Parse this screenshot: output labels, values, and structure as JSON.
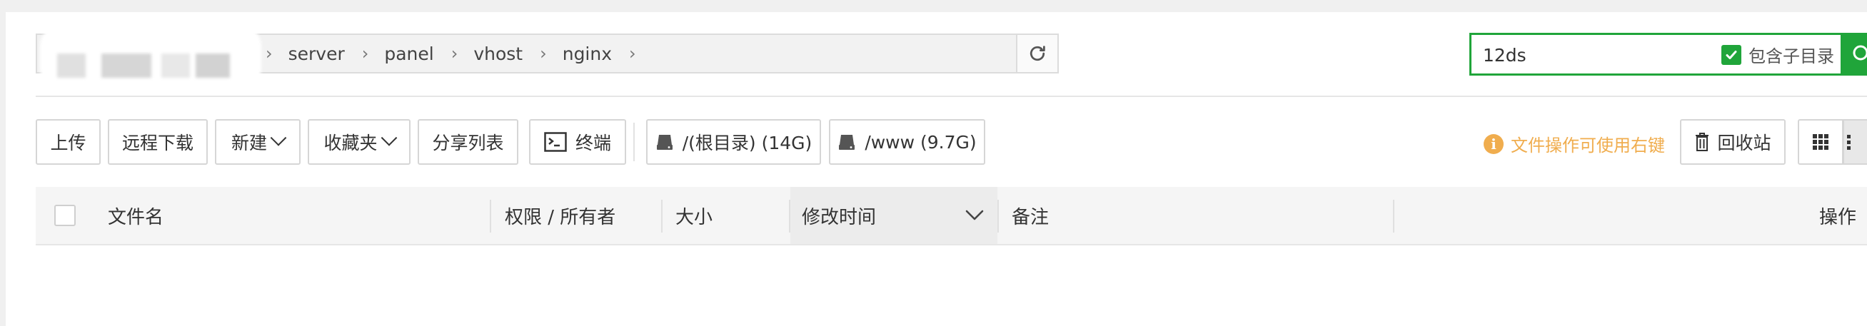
{
  "path": {
    "crumbs": [
      "server",
      "panel",
      "vhost",
      "nginx"
    ],
    "separator": "›"
  },
  "search": {
    "value": "12ds",
    "subdir_label": "包含子目录",
    "subdir_checked": true
  },
  "toolbar": {
    "upload": "上传",
    "remote_download": "远程下载",
    "new": "新建",
    "favorites": "收藏夹",
    "share_list": "分享列表",
    "terminal": "终端",
    "disk_root": "/(根目录) (14G)",
    "disk_www": "/www (9.7G)",
    "hint": "文件操作可使用右键",
    "recycle_bin": "回收站"
  },
  "table": {
    "columns": {
      "filename": "文件名",
      "permission": "权限 / 所有者",
      "size": "大小",
      "mtime": "修改时间",
      "note": "备注",
      "actions": "操作"
    }
  },
  "colors": {
    "accent": "#20a53a",
    "warning": "#f0ad4e"
  }
}
